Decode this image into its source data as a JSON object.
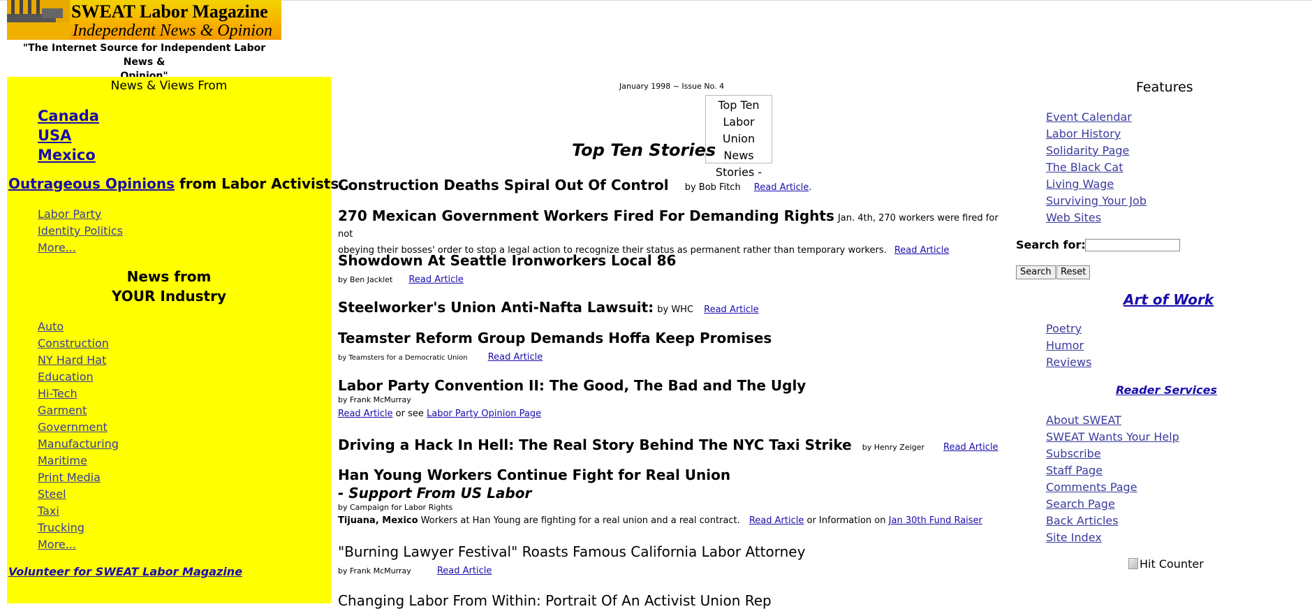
{
  "header": {
    "logo_line1": "SWEAT Labor Magazine",
    "logo_line2": "Independent News & Opinion",
    "tagline_line1": "\"The Internet Source for Independent Labor News &",
    "tagline_line2": "Opinion\""
  },
  "left": {
    "news_views_from": "News & Views From",
    "regions": [
      "Canada",
      "USA",
      "Mexico"
    ],
    "outrageous_link": "Outrageous Opinions",
    "outrageous_rest": " from Labor Activists..",
    "opinion_links": [
      "Labor Party",
      "Identity Politics",
      "More..."
    ],
    "industry_title_line1": "News from",
    "industry_title_line2": "YOUR Industry",
    "industries": [
      "Auto",
      "Construction",
      "NY Hard Hat",
      "Education",
      "Hi-Tech",
      "Garment",
      "Government",
      "Manufacturing",
      "Maritime",
      "Print Media",
      "Steel",
      "Taxi",
      "Trucking",
      "More..."
    ],
    "volunteer": "Volunteer for  SWEAT  Labor Magazine"
  },
  "center": {
    "issue": "January 1998 ~ Issue No. 4",
    "top_ten_label": "Top Ten Stories",
    "broken_image_alt": "Top Ten Labor Union News Stories -",
    "stories": [
      {
        "title": "Construction Deaths Spiral Out Of Control",
        "by": "by Bob Fitch",
        "link": "Read Article",
        "after": "."
      },
      {
        "title": "270 Mexican Government Workers Fired For Demanding Rights",
        "summary_a": "Jan. 4th, 270 workers were fired for not",
        "summary_b": "obeying their bosses' order to stop a legal action to recognize their status as permanent rather than temporary workers.",
        "link": "Read Article"
      },
      {
        "title": "Showdown At Seattle Ironworkers Local 86",
        "by": "by Ben Jacklet",
        "link": "Read Article"
      },
      {
        "title": "Steelworker's Union Anti-Nafta Lawsuit:",
        "by": "by WHC",
        "link": "Read Article"
      },
      {
        "title": "Teamster Reform Group Demands Hoffa Keep Promises",
        "by": "by Teamsters for a Democratic Union",
        "link": "Read Article"
      },
      {
        "title": "Labor Party Convention II: The Good, The Bad and The Ugly",
        "by": "by Frank McMurray",
        "link": "Read Article",
        "mid": " or see ",
        "link2": "Labor Party Opinion Page"
      },
      {
        "title": "Driving a Hack In Hell:  The Real Story Behind The NYC Taxi Strike",
        "by": "by Henry Zeiger",
        "link": "Read Article"
      },
      {
        "title": "Han Young Workers Continue Fight for Real Union",
        "subtitle": "- Support From US Labor",
        "by": "by Campaign for Labor Rights",
        "place": "Tijuana, Mexico",
        "summary": " Workers at Han Young are fighting for a real union and a real contract.",
        "link": "Read Article",
        "mid": " or Information on ",
        "link2": "Jan 30th Fund Raiser"
      },
      {
        "title": "\"Burning Lawyer Festival\" Roasts Famous California Labor Attorney",
        "by": "by Frank McMurray",
        "link": "Read Article"
      },
      {
        "title": "Changing Labor From Within: Portrait Of An Activist Union Rep"
      }
    ]
  },
  "right": {
    "features_title": "Features",
    "features": [
      "Event Calendar",
      "Labor History",
      "Solidarity Page",
      "The Black Cat",
      "Living Wage",
      "Surviving Your Job",
      "Web Sites"
    ],
    "search_label": "Search for:",
    "search_value": "",
    "search_button": "Search",
    "reset_button": "Reset",
    "art_title": "Art of Work",
    "art_links": [
      "Poetry",
      "Humor",
      "Reviews"
    ],
    "reader_title": "Reader Services",
    "reader_links": [
      "About SWEAT",
      "SWEAT Wants Your Help",
      "Subscribe",
      "Staff Page",
      "Comments Page",
      "Search Page",
      "Back Articles",
      "Site Index"
    ],
    "hit_counter_alt": "Hit Counter"
  }
}
